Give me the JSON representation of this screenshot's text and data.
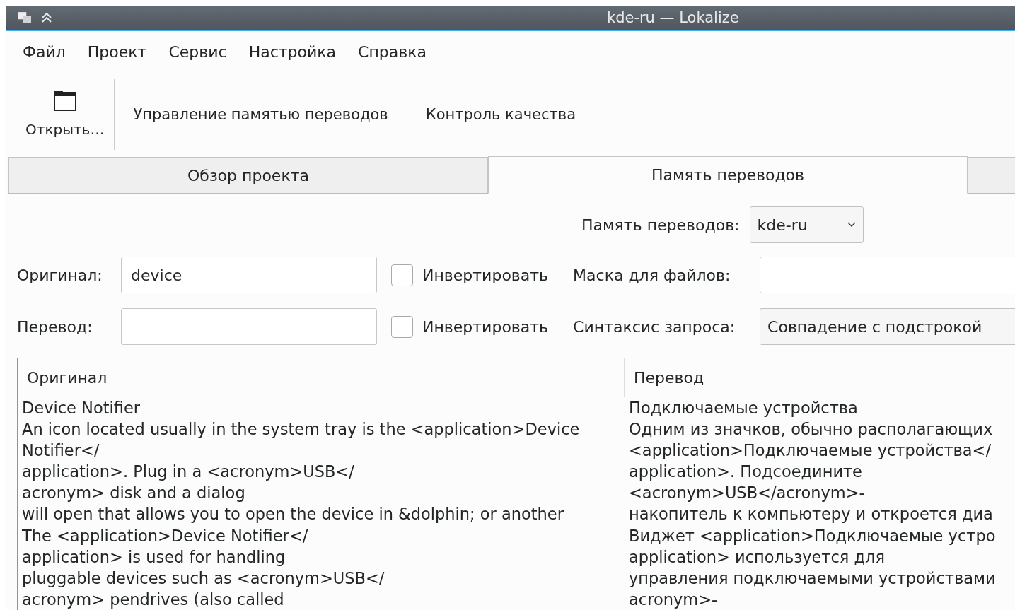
{
  "window": {
    "title": "kde-ru — Lokalize"
  },
  "menu": [
    "Файл",
    "Проект",
    "Сервис",
    "Настройка",
    "Справка"
  ],
  "toolbar": [
    {
      "kind": "icon",
      "label": "Открыть…"
    },
    {
      "kind": "text",
      "label": "Управление памятью переводов"
    },
    {
      "kind": "text",
      "label": "Контроль качества"
    }
  ],
  "tabs": [
    {
      "label": "Обзор проекта",
      "selected": false
    },
    {
      "label": "Память переводов",
      "selected": true
    }
  ],
  "memory": {
    "label": "Память переводов:",
    "value": "kde-ru"
  },
  "filters": [
    {
      "label": "Оригинал:",
      "value": "device",
      "invert_label": "Инвертировать",
      "invert_checked": false
    },
    {
      "label": "Перевод:",
      "invert_label": "Инвертировать",
      "invert_checked": false
    }
  ],
  "file_mask": {
    "label": "Маска для файлов:"
  },
  "query_syntax": {
    "label": "Синтаксис запроса:",
    "value": "Совпадение с подстрокой"
  },
  "table": {
    "columns": [
      "Оригинал",
      "Перевод"
    ],
    "rows": [
      {
        "original": "Device Notifier",
        "translation": "Подключаемые устройства"
      },
      {
        "original": "An icon located usually in the system tray is the <application>Device\nNotifier</\napplication>. Plug in a <acronym>USB</\nacronym> disk and a dialog\nwill open that allows you to open the device in &dolphin; or another",
        "translation": "Одним из значков, обычно располагающих\n<application>Подключаемые устройства</\napplication>. Подсоедините\n<acronym>USB</acronym>-\nнакопитель к компьютеру и откроется диа"
      },
      {
        "original": "The <application>Device Notifier</\napplication> is used for handling\npluggable devices such as <acronym>USB</\nacronym> pendrives (also called",
        "translation": "Виджет <application>Подключаемые устро\napplication> используется для\nуправления подключаемыми устройствами\nacronym>-"
      }
    ]
  }
}
